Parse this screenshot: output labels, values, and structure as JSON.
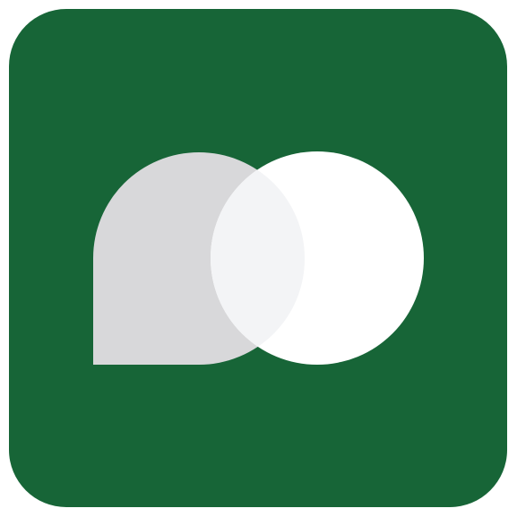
{
  "icon": {
    "name": "app-icon",
    "shapes": [
      "speech-bubble-icon",
      "circle-icon"
    ]
  },
  "colors": {
    "tile": "#176537",
    "bubble": "#d8d8da",
    "circle": "#ffffff",
    "overlap": "#f3f4f6"
  }
}
